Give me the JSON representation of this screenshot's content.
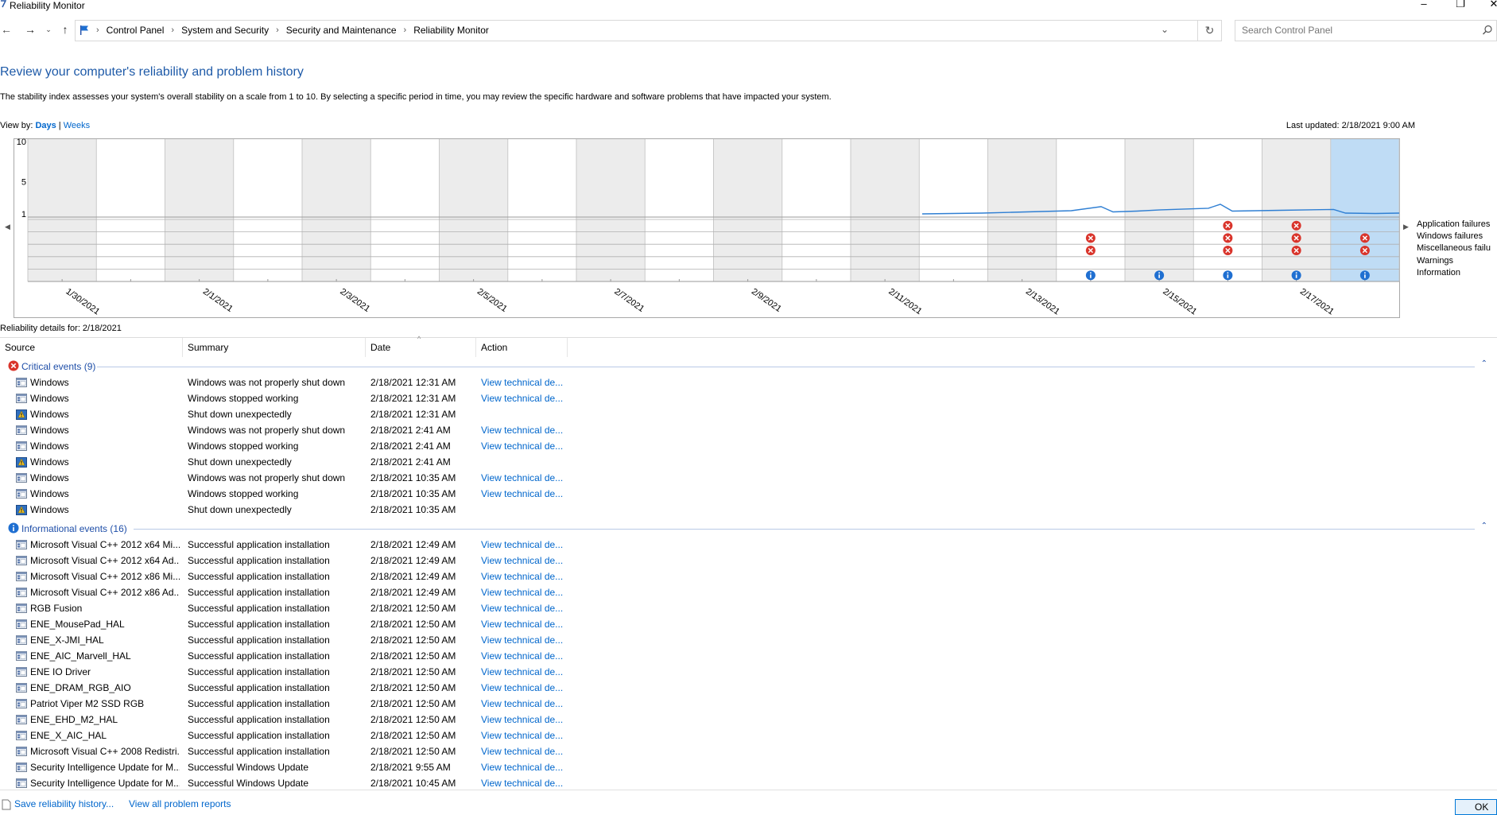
{
  "window": {
    "title": "Reliability Monitor"
  },
  "address": {
    "crumbs": [
      "Control Panel",
      "System and Security",
      "Security and Maintenance",
      "Reliability Monitor"
    ],
    "search_placeholder": "Search Control Panel"
  },
  "header": {
    "heading": "Review your computer's reliability and problem history",
    "description": "The stability index assesses your system's overall stability on a scale from 1 to 10. By selecting a specific period in time, you may review the specific hardware and software problems that have impacted your system.",
    "view_by_label": "View by:",
    "view_days": "Days",
    "view_sep": "|",
    "view_weeks": "Weeks",
    "last_updated": "Last updated: 2/18/2021 9:00 AM"
  },
  "chart_data": {
    "type": "line",
    "y_ticks": [
      "10",
      "5",
      "1"
    ],
    "ylim": [
      1,
      10
    ],
    "x_labels": [
      "1/30/2021",
      "2/1/2021",
      "2/3/2021",
      "2/5/2021",
      "2/7/2021",
      "2/9/2021",
      "2/11/2021",
      "2/13/2021",
      "2/15/2021",
      "2/17/2021"
    ],
    "row_labels": [
      "Application failures",
      "Windows failures",
      "Miscellaneous failu",
      "Warnings",
      "Information"
    ],
    "columns": 20,
    "selected_column": 19,
    "stability_line": [
      [
        15,
        1.0
      ],
      [
        15.5,
        1.05
      ],
      [
        16,
        1.1
      ],
      [
        16.5,
        1.2
      ],
      [
        17,
        1.3
      ],
      [
        17.5,
        1.4
      ],
      [
        18,
        1.9
      ],
      [
        18.2,
        1.25
      ],
      [
        18.6,
        1.35
      ],
      [
        19,
        1.5
      ],
      [
        19.4,
        1.6
      ],
      [
        19.8,
        1.7
      ],
      [
        20,
        2.2
      ],
      [
        20.2,
        1.35
      ],
      [
        21,
        1.45
      ],
      [
        21.9,
        1.55
      ],
      [
        22.1,
        1.1
      ],
      [
        22.6,
        1.05
      ],
      [
        23,
        1.1
      ]
    ],
    "error_marks": [
      {
        "row": 1,
        "col": 15
      },
      {
        "row": 2,
        "col": 15
      },
      {
        "row": 0,
        "col": 17
      },
      {
        "row": 1,
        "col": 17
      },
      {
        "row": 2,
        "col": 17
      },
      {
        "row": 0,
        "col": 18
      },
      {
        "row": 1,
        "col": 18
      },
      {
        "row": 2,
        "col": 18
      },
      {
        "row": 1,
        "col": 19
      },
      {
        "row": 2,
        "col": 19
      }
    ],
    "info_marks": [
      15,
      16,
      17,
      18,
      19
    ]
  },
  "details": {
    "title": "Reliability details for: 2/18/2021",
    "columns": [
      "Source",
      "Summary",
      "Date",
      "Action"
    ],
    "groups": [
      {
        "label": "Critical events (9)",
        "kind": "critical",
        "rows": [
          {
            "icon": "window",
            "source": "Windows",
            "summary": "Windows was not properly shut down",
            "date": "2/18/2021 12:31 AM",
            "action": "View technical de..."
          },
          {
            "icon": "window",
            "source": "Windows",
            "summary": "Windows stopped working",
            "date": "2/18/2021 12:31 AM",
            "action": "View technical de..."
          },
          {
            "icon": "shield",
            "source": "Windows",
            "summary": "Shut down unexpectedly",
            "date": "2/18/2021 12:31 AM",
            "action": ""
          },
          {
            "icon": "window",
            "source": "Windows",
            "summary": "Windows was not properly shut down",
            "date": "2/18/2021 2:41 AM",
            "action": "View technical de..."
          },
          {
            "icon": "window",
            "source": "Windows",
            "summary": "Windows stopped working",
            "date": "2/18/2021 2:41 AM",
            "action": "View technical de..."
          },
          {
            "icon": "shield",
            "source": "Windows",
            "summary": "Shut down unexpectedly",
            "date": "2/18/2021 2:41 AM",
            "action": ""
          },
          {
            "icon": "window",
            "source": "Windows",
            "summary": "Windows was not properly shut down",
            "date": "2/18/2021 10:35 AM",
            "action": "View technical de..."
          },
          {
            "icon": "window",
            "source": "Windows",
            "summary": "Windows stopped working",
            "date": "2/18/2021 10:35 AM",
            "action": "View technical de..."
          },
          {
            "icon": "shield",
            "source": "Windows",
            "summary": "Shut down unexpectedly",
            "date": "2/18/2021 10:35 AM",
            "action": ""
          }
        ]
      },
      {
        "label": "Informational events (16)",
        "kind": "info",
        "rows": [
          {
            "icon": "window",
            "source": "Microsoft Visual C++ 2012 x64 Mi...",
            "summary": "Successful application installation",
            "date": "2/18/2021 12:49 AM",
            "action": "View technical de..."
          },
          {
            "icon": "window",
            "source": "Microsoft Visual C++ 2012 x64 Ad...",
            "summary": "Successful application installation",
            "date": "2/18/2021 12:49 AM",
            "action": "View technical de..."
          },
          {
            "icon": "window",
            "source": "Microsoft Visual C++ 2012 x86 Mi...",
            "summary": "Successful application installation",
            "date": "2/18/2021 12:49 AM",
            "action": "View technical de..."
          },
          {
            "icon": "window",
            "source": "Microsoft Visual C++ 2012 x86 Ad...",
            "summary": "Successful application installation",
            "date": "2/18/2021 12:49 AM",
            "action": "View technical de..."
          },
          {
            "icon": "window",
            "source": "RGB Fusion",
            "summary": "Successful application installation",
            "date": "2/18/2021 12:50 AM",
            "action": "View technical de..."
          },
          {
            "icon": "window",
            "source": "ENE_MousePad_HAL",
            "summary": "Successful application installation",
            "date": "2/18/2021 12:50 AM",
            "action": "View technical de..."
          },
          {
            "icon": "window",
            "source": "ENE_X-JMI_HAL",
            "summary": "Successful application installation",
            "date": "2/18/2021 12:50 AM",
            "action": "View technical de..."
          },
          {
            "icon": "window",
            "source": "ENE_AIC_Marvell_HAL",
            "summary": "Successful application installation",
            "date": "2/18/2021 12:50 AM",
            "action": "View technical de..."
          },
          {
            "icon": "window",
            "source": "ENE IO Driver",
            "summary": "Successful application installation",
            "date": "2/18/2021 12:50 AM",
            "action": "View technical de..."
          },
          {
            "icon": "window",
            "source": "ENE_DRAM_RGB_AIO",
            "summary": "Successful application installation",
            "date": "2/18/2021 12:50 AM",
            "action": "View technical de..."
          },
          {
            "icon": "window",
            "source": "Patriot Viper M2 SSD RGB",
            "summary": "Successful application installation",
            "date": "2/18/2021 12:50 AM",
            "action": "View technical de..."
          },
          {
            "icon": "window",
            "source": "ENE_EHD_M2_HAL",
            "summary": "Successful application installation",
            "date": "2/18/2021 12:50 AM",
            "action": "View technical de..."
          },
          {
            "icon": "window",
            "source": "ENE_X_AIC_HAL",
            "summary": "Successful application installation",
            "date": "2/18/2021 12:50 AM",
            "action": "View technical de..."
          },
          {
            "icon": "window",
            "source": "Microsoft Visual C++ 2008 Redistri...",
            "summary": "Successful application installation",
            "date": "2/18/2021 12:50 AM",
            "action": "View technical de..."
          },
          {
            "icon": "window",
            "source": "Security Intelligence Update for M...",
            "summary": "Successful Windows Update",
            "date": "2/18/2021 9:55 AM",
            "action": "View technical de..."
          },
          {
            "icon": "window",
            "source": "Security Intelligence Update for M...",
            "summary": "Successful Windows Update",
            "date": "2/18/2021 10:45 AM",
            "action": "View technical de..."
          }
        ]
      }
    ]
  },
  "footer": {
    "save_link": "Save reliability history...",
    "problems_link": "View all problem reports",
    "ok_label": "OK"
  },
  "colors": {
    "heading": "#1e5aa8",
    "link": "#0066cc",
    "selected_column": "#bfdcf5",
    "line": "#2f7fd3",
    "error": "#d9342b",
    "info": "#1f6fd1"
  }
}
